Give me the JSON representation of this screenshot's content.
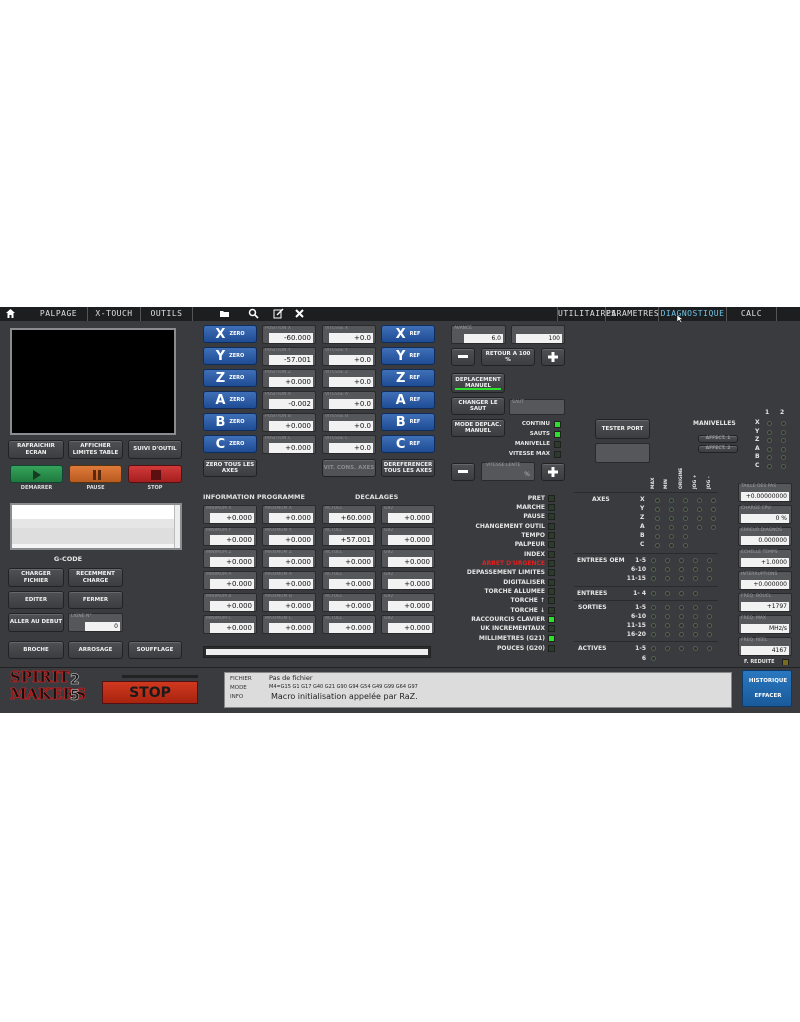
{
  "topbar": {
    "tabs_left": [
      "PALPAGE",
      "X-TOUCH",
      "OUTILS"
    ],
    "tabs_right": [
      "UTILITAIRES",
      "PARAMETRES",
      "DIAGNOSTIQUE",
      "CALC"
    ],
    "active_tab": "DIAGNOSTIQUE",
    "icons": [
      "home-icon",
      "folder-icon",
      "search-icon",
      "edit-icon",
      "close-icon"
    ]
  },
  "left": {
    "btn_refresh": "RAFRAICHIR ECRAN",
    "btn_limits": "AFFICHER LIMITES TABLE",
    "btn_follow": "SUIVI D'OUTIL",
    "start_label": "DEMARRER",
    "pause_label": "PAUSE",
    "stop_label": "STOP",
    "gcode_title": "G-CODE",
    "btn_load": "CHARGER FICHIER",
    "btn_recent": "RECEMMENT CHARGE",
    "btn_edit": "EDITER",
    "btn_close": "FERMER",
    "btn_goto_start": "ALLER AU DEBUT",
    "line_label": "LIGNE N°",
    "line_value": "0",
    "btn_spindle": "BROCHE",
    "btn_coolant": "ARROSAGE",
    "btn_blow": "SOUFFLAGE"
  },
  "axes": [
    {
      "axis": "X",
      "pos_label": "POSITION X",
      "pos": "-60.000",
      "vit_label": "VITESSE X",
      "vit": "+0.0"
    },
    {
      "axis": "Y",
      "pos_label": "POSITION Y",
      "pos": "-57.001",
      "vit_label": "VITESSE Y",
      "vit": "+0.0"
    },
    {
      "axis": "Z",
      "pos_label": "POSITION Z",
      "pos": "+0.000",
      "vit_label": "VITESSE Z",
      "vit": "+0.0"
    },
    {
      "axis": "A",
      "pos_label": "POSITION A",
      "pos": "-0.002",
      "vit_label": "VITESSE A",
      "vit": "+0.0"
    },
    {
      "axis": "B",
      "pos_label": "POSITION B",
      "pos": "+0.000",
      "vit_label": "VITESSE B",
      "vit": "+0.0"
    },
    {
      "axis": "C",
      "pos_label": "POSITION C",
      "pos": "+0.000",
      "vit_label": "VITESSE C",
      "vit": "+0.0"
    }
  ],
  "zero_suffix": "ZERO",
  "ref_suffix": "REF",
  "btn_zero_all": "ZERO TOUS LES AXES",
  "btn_vit_cons": "VIT. CONS. AXES",
  "btn_deref": "DEREFERENCER TOUS LES AXES",
  "info_title": "INFORMATION PROGRAMME",
  "offsets_title": "DECALAGES",
  "info_rows": [
    [
      "+0.000",
      "+0.000",
      "+60.000",
      "+0.000"
    ],
    [
      "+0.000",
      "+0.000",
      "+57.001",
      "+0.000"
    ],
    [
      "+0.000",
      "+0.000",
      "+0.000",
      "+0.000"
    ],
    [
      "+0.000",
      "+0.000",
      "+0.000",
      "+0.000"
    ],
    [
      "+0.000",
      "+0.000",
      "+0.000",
      "+0.000"
    ],
    [
      "+0.000",
      "+0.000",
      "+0.000",
      "+0.000"
    ]
  ],
  "info_labels": [
    [
      "MINIMUM X",
      "MAXIMUM X",
      "ACTUEL",
      "G92"
    ],
    [
      "MINIMUM Y",
      "MAXIMUM Y",
      "ACTUEL",
      "G92"
    ],
    [
      "MINIMUM Z",
      "MAXIMUM Z",
      "ACTUEL",
      "G92"
    ],
    [
      "MINIMUM A",
      "MAXIMUM A",
      "ACTUEL",
      "G92"
    ],
    [
      "MINIMUM B",
      "MAXIMUM B",
      "ACTUEL",
      "G92"
    ],
    [
      "MINIMUM C",
      "MAXIMUM C",
      "ACTUEL",
      "G92"
    ]
  ],
  "feed": {
    "avance_label": "AVANCE",
    "avance": "6.0",
    "pct": "100",
    "btn_reset": "RETOUR A 100 %",
    "btn_manual": "DEPLACEMENT MANUEL",
    "btn_step": "CHANGER LE SAUT",
    "step_label": "SAUT",
    "btn_mode": "MODE DEPLAC. MANUEL",
    "vitesse_label": "VITESSE LENTE",
    "vitesse_unit": "%"
  },
  "modes": [
    {
      "label": "CONTINU",
      "on": true
    },
    {
      "label": "SAUTS",
      "on": true
    },
    {
      "label": "MANIVELLE",
      "on": false
    },
    {
      "label": "VITESSE MAX",
      "on": false
    }
  ],
  "status": [
    {
      "label": "PRET",
      "on": false,
      "color": "#e6e6e6"
    },
    {
      "label": "MARCHE",
      "on": false,
      "color": "#e6e6e6"
    },
    {
      "label": "PAUSE",
      "on": false,
      "color": "#e6e6e6"
    },
    {
      "label": "CHANGEMENT OUTIL",
      "on": false,
      "color": "#e6e6e6"
    },
    {
      "label": "TEMPO",
      "on": false,
      "color": "#e6e6e6"
    },
    {
      "label": "PALPEUR",
      "on": false,
      "color": "#e6e6e6"
    },
    {
      "label": "INDEX",
      "on": false,
      "color": "#e6e6e6"
    },
    {
      "label": "ARRET D'URGENCE",
      "on": false,
      "color": "#e02020"
    },
    {
      "label": "DEPASSEMENT LIMITES",
      "on": false,
      "color": "#e6e6e6"
    },
    {
      "label": "DIGITALISER",
      "on": false,
      "color": "#e6e6e6"
    },
    {
      "label": "TORCHE ALLUMEE",
      "on": false,
      "color": "#e6e6e6"
    },
    {
      "label": "TORCHE ↑",
      "on": false,
      "color": "#e6e6e6"
    },
    {
      "label": "TORCHE ↓",
      "on": false,
      "color": "#e6e6e6"
    },
    {
      "label": "RACCOURCIS CLAVIER",
      "on": true,
      "color": "#e6e6e6"
    },
    {
      "label": "UK INCREMENTAUX",
      "on": false,
      "color": "#e6e6e6"
    },
    {
      "label": "MILLIMETRES (G21)",
      "on": true,
      "color": "#e6e6e6"
    },
    {
      "label": "POUCES (G20)",
      "on": false,
      "color": "#e6e6e6"
    }
  ],
  "diag": {
    "btn_test_port": "TESTER PORT",
    "axes_title": "AXES",
    "axes_letters": [
      "X",
      "Y",
      "Z",
      "A",
      "B",
      "C"
    ],
    "col_headers": [
      "MAX",
      "MIN",
      "ORIGINE",
      "JOG +",
      "JOG -"
    ],
    "manivelles_title": "MANIVELLES",
    "manivelle_cols": [
      "1",
      "2"
    ],
    "btn_affect1": "AFFECT. 1",
    "btn_affect2": "AFFECT. 2",
    "oem_title": "ENTREES OEM",
    "oem_ranges": [
      "1-5",
      "6-10",
      "11-15"
    ],
    "entrees_title": "ENTREES",
    "entrees_range": "1- 4",
    "sorties_title": "SORTIES",
    "sorties_ranges": [
      "1-5",
      "6-10",
      "11-15",
      "16-20"
    ],
    "actives_title": "ACTIVES",
    "actives_ranges": [
      "1-5",
      "6"
    ]
  },
  "right_fields": [
    {
      "label": "TAILLE DES PAS",
      "value": "+0.00000000"
    },
    {
      "label": "CHARGE CPU",
      "value": "0 %"
    },
    {
      "label": "ERREUR DIAGNOS",
      "value": "0.000000"
    },
    {
      "label": "ECHELLE TEMPS",
      "value": "+1.0000"
    },
    {
      "label": "INTERRUPTIONS",
      "value": "+0.000000"
    },
    {
      "label": "FREQ. BOUCL",
      "value": "+1797"
    },
    {
      "label": "FREQ. MAX",
      "value": "MHz/s"
    },
    {
      "label": "FREQ. REEL",
      "value": "4167"
    }
  ],
  "reduced_label": "F. REDUITE",
  "bottom": {
    "logo_line1": "SPIRIT",
    "logo_line2": "MAKERS",
    "logo_digits": [
      "2",
      "5"
    ],
    "stop_label": "STOP",
    "fichier_label": "FICHIER",
    "fichier_value": "Pas de fichier",
    "mode_label": "MODE",
    "mode_value": "M4=G15  G1 G17 G40 G21 G90 G94 G54 G49 G99 G64 G97",
    "info_label": "INFO",
    "info_value": "Macro initialisation appelée par RaZ.",
    "btn_history": "HISTORIQUE",
    "btn_clear": "EFFACER"
  }
}
